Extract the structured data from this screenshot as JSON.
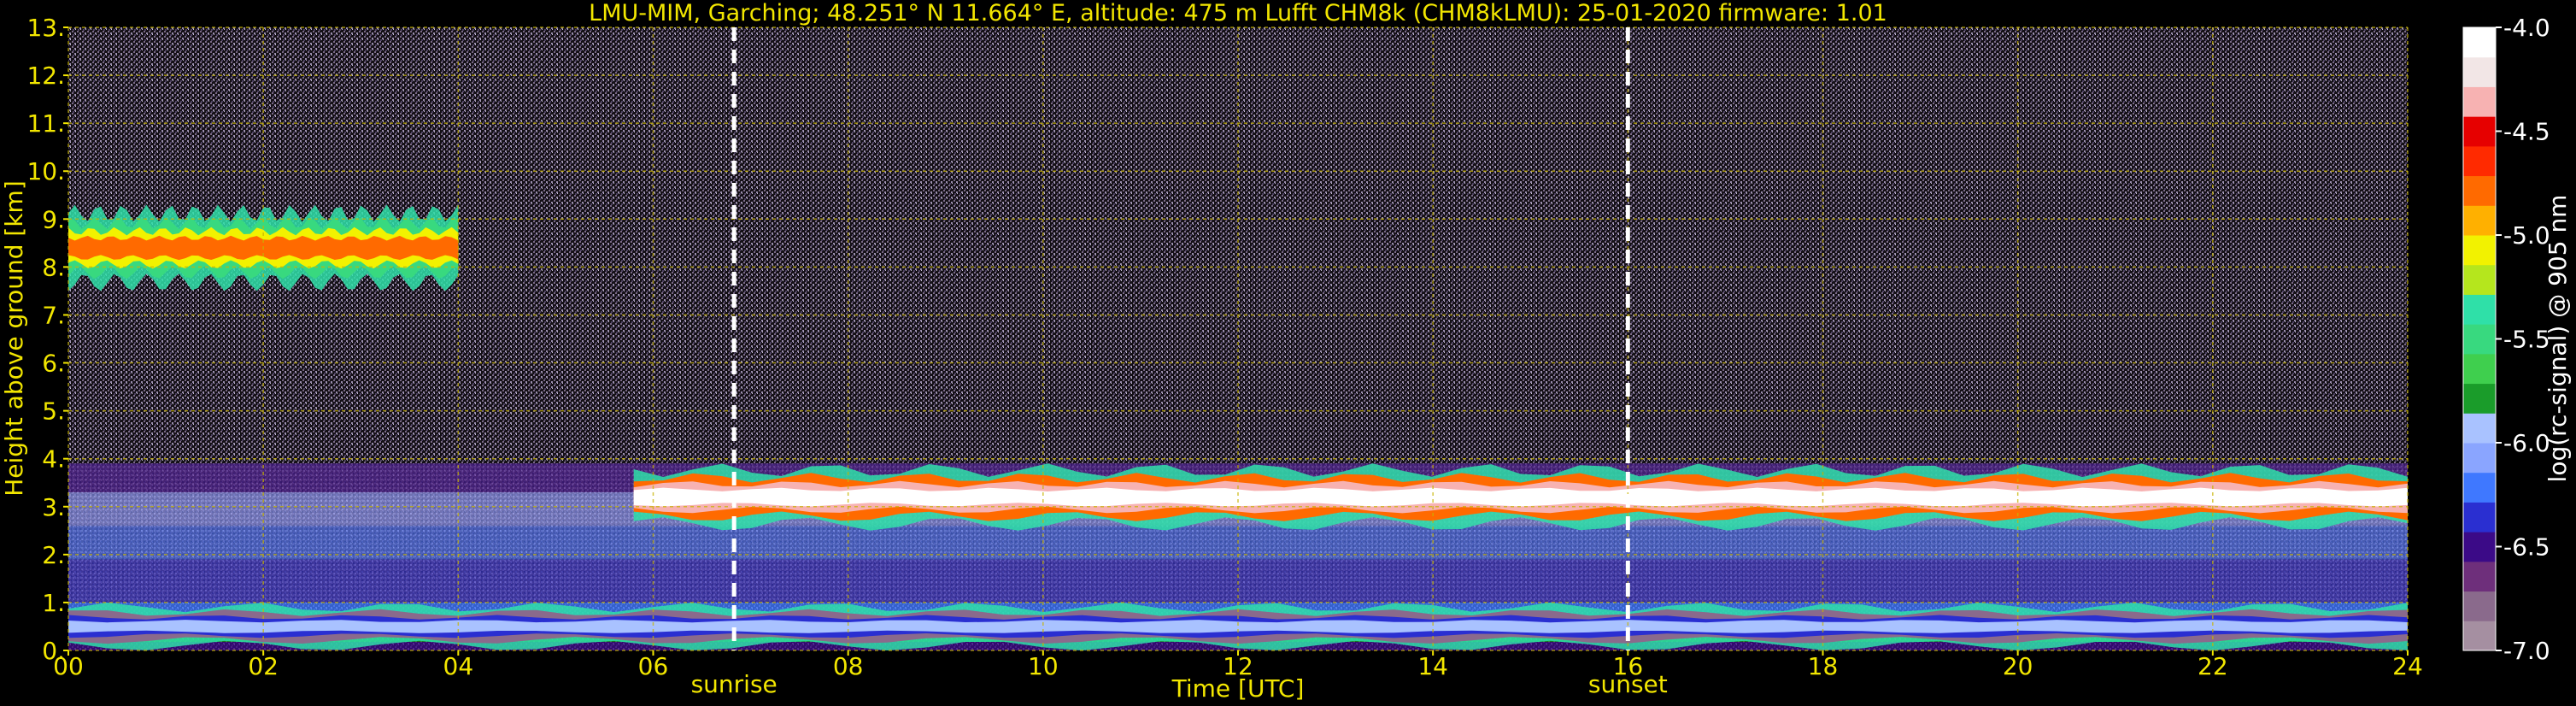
{
  "chart_data": {
    "type": "heatmap",
    "title": "LMU-MIM, Garching; 48.251° N 11.664° E, altitude: 475 m    Lufft CHM8k (CHM8kLMU): 25-01-2020    firmware: 1.01",
    "xlabel": "Time [UTC]",
    "ylabel": "Height above ground [km]",
    "colorbar_label": "log(rc-signal) @ 905 nm",
    "xlim": [
      0,
      24
    ],
    "ylim": [
      0,
      13
    ],
    "clim": [
      -7.0,
      -4.0
    ],
    "grid": true,
    "x_ticks": [
      "00",
      "02",
      "04",
      "06",
      "08",
      "10",
      "12",
      "14",
      "16",
      "18",
      "20",
      "22",
      "24"
    ],
    "y_ticks": [
      "0.",
      "1.",
      "2.",
      "3.",
      "4.",
      "5.",
      "6.",
      "7.",
      "8.",
      "9.",
      "10.",
      "11.",
      "12.",
      "13."
    ],
    "colorbar_ticks": [
      "-4.0",
      "-4.5",
      "-5.0",
      "-5.5",
      "-6.0",
      "-6.5",
      "-7.0"
    ],
    "colorbar_tick_values": [
      -4.0,
      -4.5,
      -5.0,
      -5.5,
      -6.0,
      -6.5,
      -7.0
    ],
    "markers": [
      {
        "label": "sunrise",
        "time": 6.83
      },
      {
        "label": "sunset",
        "time": 16.0
      }
    ],
    "features": [
      {
        "time_start": 0.0,
        "time_end": 4.0,
        "height_min": 7.5,
        "height_max": 9.3,
        "max_log_signal": -4.7
      },
      {
        "time_start": 5.8,
        "time_end": 24.0,
        "height_min": 2.5,
        "height_max": 3.9,
        "max_log_signal": -4.0
      },
      {
        "time_start": 0.0,
        "time_end": 24.0,
        "height_min": 0.0,
        "height_max": 1.0,
        "max_log_signal": -6.0
      }
    ]
  },
  "colors": {
    "axis_text": "#f2e600",
    "grid": "#c8b400",
    "colorbar_text": "#ffffff",
    "colormap": [
      "#a58fa1",
      "#8a6a8c",
      "#6e2f7b",
      "#3b0a87",
      "#2a2fd1",
      "#3f78ff",
      "#8aa5ff",
      "#a9c2ff",
      "#1a9c2a",
      "#3fcf4e",
      "#38d97f",
      "#2fe0a8",
      "#b5e61d",
      "#f2f200",
      "#ffb000",
      "#ff6a00",
      "#ff2a00",
      "#e60000",
      "#f7b2b2",
      "#f2e6e6",
      "#ffffff"
    ]
  }
}
